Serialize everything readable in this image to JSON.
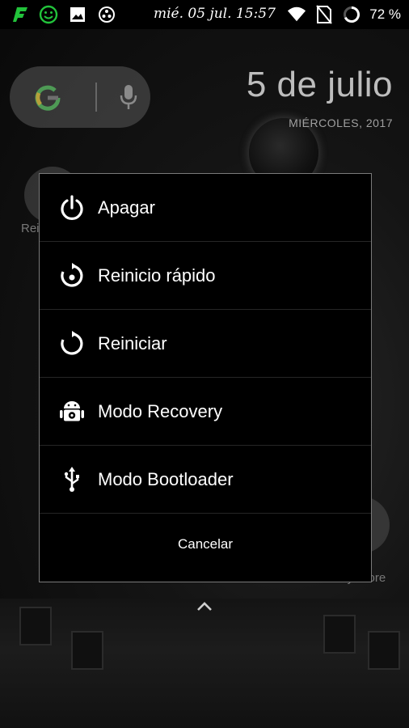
{
  "status_bar": {
    "datetime": "mié. 05 jul. 15:57",
    "battery_percent": "72 %",
    "icons": [
      "app-f-icon",
      "smiley-icon",
      "image-icon",
      "circle-dots-icon",
      "wifi-icon",
      "no-sim-icon",
      "battery-ring-icon"
    ]
  },
  "home": {
    "date_big": "5 de julio",
    "date_sub": "MIÉRCOLES, 2017",
    "bg_label_left": "Reinicio",
    "bg_label_right": "Play Store"
  },
  "power_menu": {
    "items": [
      {
        "label": "Apagar",
        "icon": "power-icon"
      },
      {
        "label": "Reinicio rápido",
        "icon": "quick-reboot-icon"
      },
      {
        "label": "Reiniciar",
        "icon": "reboot-icon"
      },
      {
        "label": "Modo Recovery",
        "icon": "android-settings-icon"
      },
      {
        "label": "Modo Bootloader",
        "icon": "usb-icon"
      }
    ],
    "cancel_label": "Cancelar"
  },
  "colors": {
    "accent_green": "#22c33b",
    "dialog_bg": "#000000",
    "dialog_border": "#7a7a7a"
  }
}
